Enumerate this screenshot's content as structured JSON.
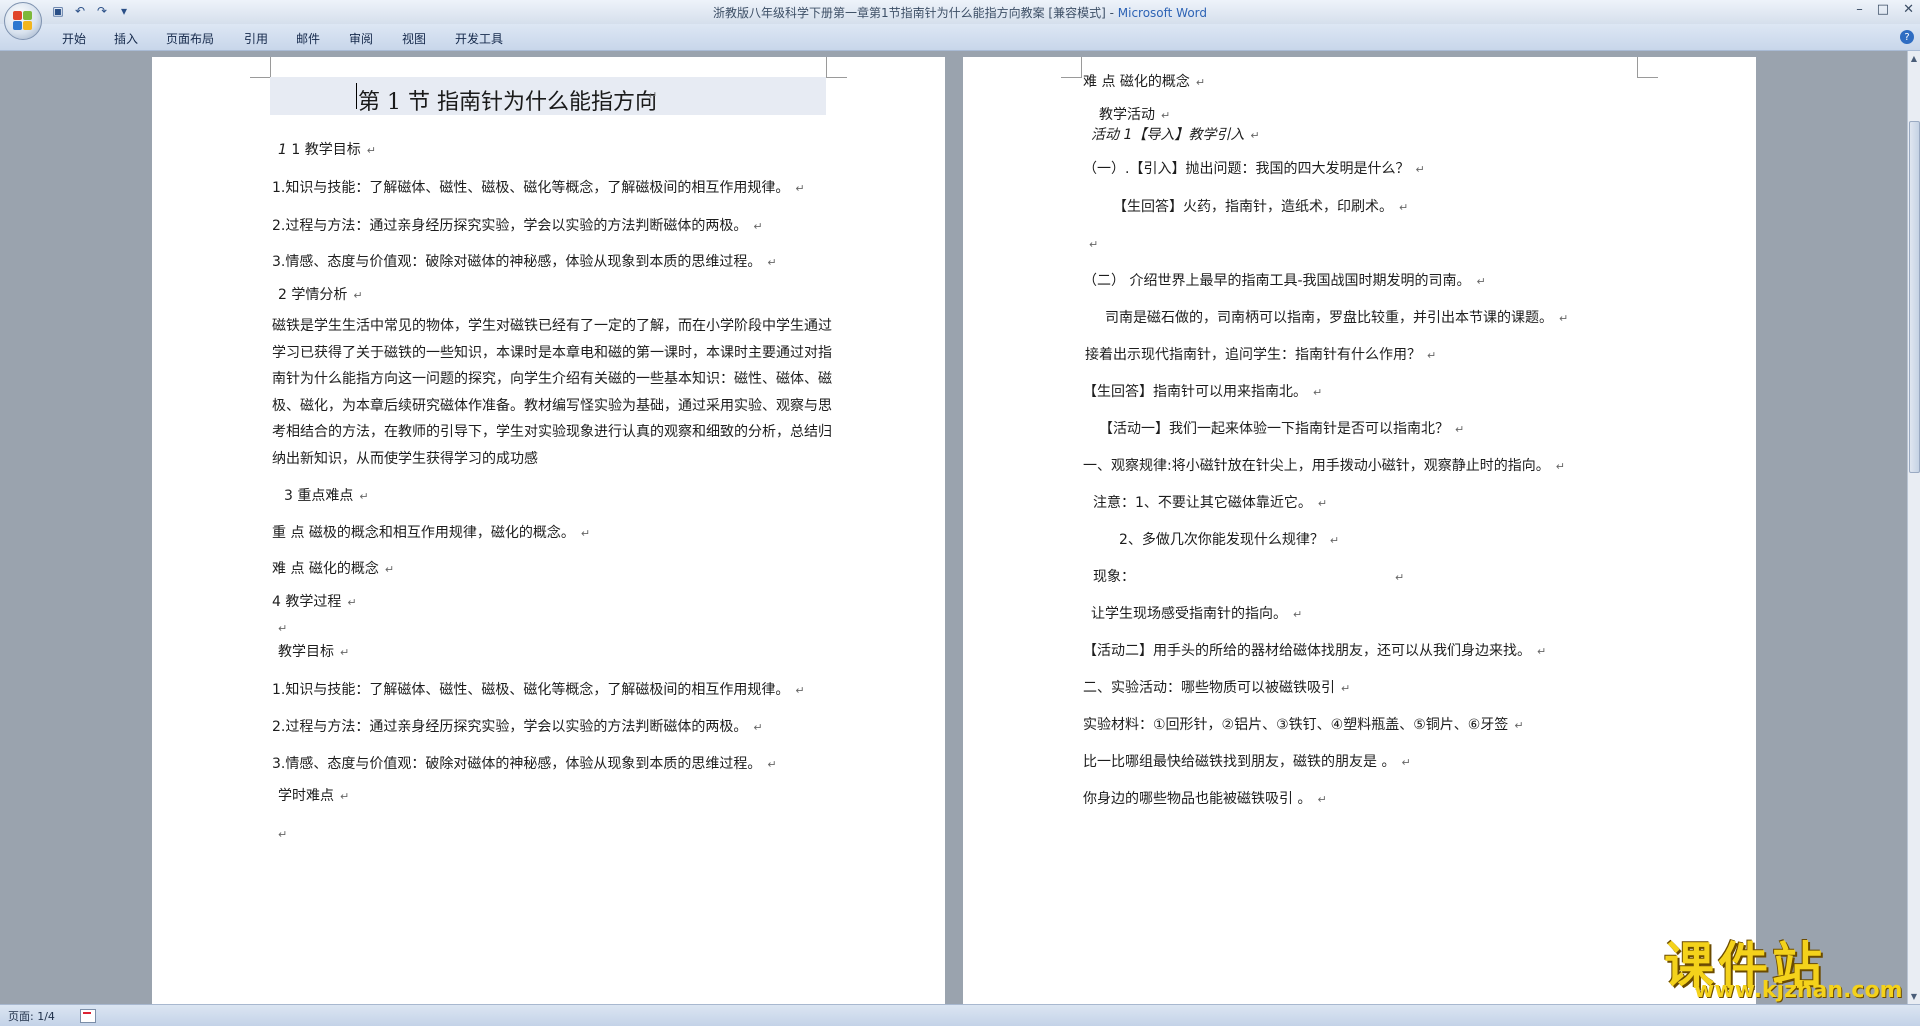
{
  "window": {
    "title_doc": "浙教版八年级科学下册第一章第1节指南针为什么能指方向教案 [兼容模式] - ",
    "title_app": "Microsoft Word",
    "controls": [
      "–",
      "□",
      "✕"
    ]
  },
  "quick_access": [
    "save-icon",
    "undo-icon",
    "redo-icon",
    "customize-icon"
  ],
  "ribbon": {
    "tabs": [
      "开始",
      "插入",
      "页面布局",
      "引用",
      "邮件",
      "审阅",
      "视图",
      "开发工具"
    ]
  },
  "left_page": {
    "title": "第 1 节   指南针为什么能指方向",
    "lines": [
      "1 教学目标",
      "1.知识与技能：了解磁体、磁性、磁极、磁化等概念，了解磁极间的相互作用规律。",
      "2.过程与方法：通过亲身经历探究实验，学会以实验的方法判断磁体的两极。",
      "3.情感、态度与价值观：破除对磁体的神秘感，体验从现象到本质的思维过程。",
      "2 学情分析",
      "3 重点难点",
      "重  点    磁极的概念和相互作用规律，磁化的概念。",
      "难  点    磁化的概念",
      "4 教学过程",
      "",
      "教学目标",
      "1.知识与技能：了解磁体、磁性、磁极、磁化等概念，了解磁极间的相互作用规律。",
      "2.过程与方法：通过亲身经历探究实验，学会以实验的方法判断磁体的两极。",
      "3.情感、态度与价值观：破除对磁体的神秘感，体验从现象到本质的思维过程。",
      "学时难点",
      ""
    ],
    "analysis": "磁铁是学生生活中常见的物体，学生对磁铁已经有了一定的了解，而在小学阶段中学生通过学习已获得了关于磁铁的一些知识，本课时是本章电和磁的第一课时，本课时主要通过对指南针为什么能指方向这一问题的探究，向学生介绍有关磁的一些基本知识：磁性、磁体、磁极、磁化，为本章后续研究磁体作准备。教材编写怪实验为基础，通过采用实验、观察与思考相结合的方法，在教师的引导下，学生对实验现象进行认真的观察和细致的分析，总结归纳出新知识，从而使学生获得学习的成功感"
  },
  "right_page": {
    "lines": [
      "难  点    磁化的概念",
      "教学活动",
      "活动 1【导入】教学引入",
      "（一）.【引入】抛出问题：我国的四大发明是什么？",
      "【生回答】火药，指南针，造纸术，印刷术。",
      "",
      "（二）  介绍世界上最早的指南工具-我国战国时期发明的司南。",
      "司南是磁石做的，司南柄可以指南，罗盘比较重，并引出本节课的课题。",
      "接着出示现代指南针，追问学生：指南针有什么作用？",
      "【生回答】指南针可以用来指南北。",
      "【活动一】我们一起来体验一下指南针是否可以指南北？",
      "一、观察规律:将小磁针放在针尖上，用手拨动小磁针，观察静止时的指向。",
      "注意：1、不要让其它磁体靠近它。",
      "2、多做几次你能发现什么规律？",
      "现象：",
      "让学生现场感受指南针的指向。",
      "【活动二】用手头的所给的器材给磁体找朋友，还可以从我们身边来找。",
      "二、实验活动：哪些物质可以被磁铁吸引",
      "实验材料：①回形针，②铝片、③铁钉、④塑料瓶盖、⑤铜片、⑥牙签",
      "比一比哪组最快给磁铁找到朋友，磁铁的朋友是                    。",
      "你身边的哪些物品也能被磁铁吸引                    。"
    ]
  },
  "status": {
    "page": "页面: 1/4"
  },
  "watermark": {
    "cn": "课件站",
    "url": "www.kjzhan.com"
  },
  "colors": {
    "workspace": "#9aa3ae",
    "ribbon": "#c8d6ea",
    "app_title": "#2d63b5",
    "watermark": "#f4d21b"
  }
}
